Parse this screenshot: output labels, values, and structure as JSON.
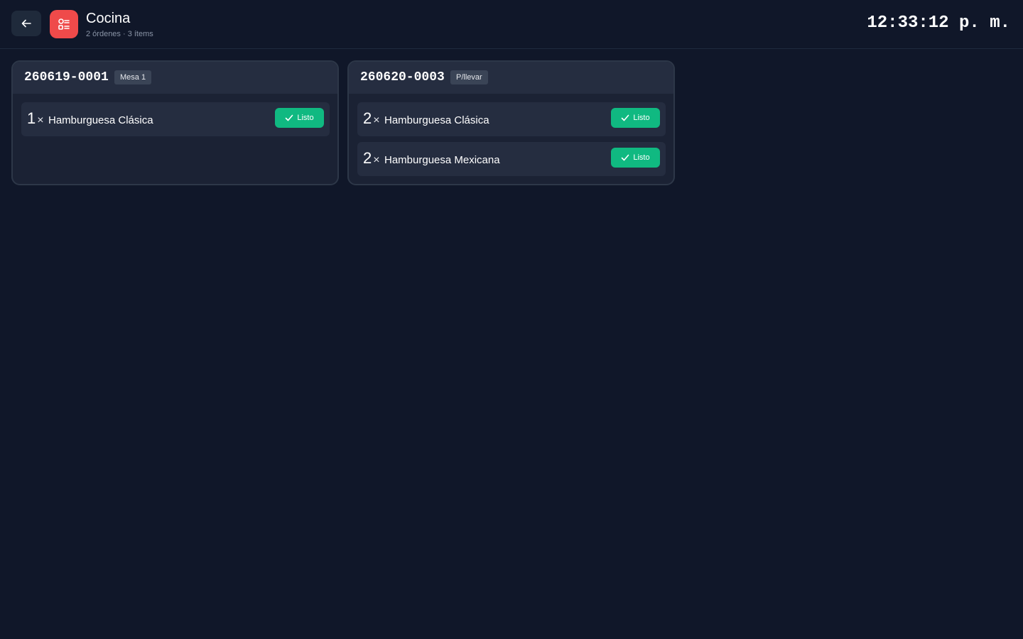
{
  "header": {
    "title": "Cocina",
    "subtitle": "2 órdenes · 3 ítems",
    "clock": "12:33:12 p. m.",
    "back_icon": "arrow-left-icon",
    "app_icon": "kitchen-ticket-icon"
  },
  "orders": [
    {
      "number": "260619-0001",
      "badge": "Mesa 1",
      "items": [
        {
          "qty": "1",
          "x": "×",
          "name": "Hamburguesa Clásica",
          "action": "Listo"
        }
      ]
    },
    {
      "number": "260620-0003",
      "badge": "P/llevar",
      "items": [
        {
          "qty": "2",
          "x": "×",
          "name": "Hamburguesa Clásica",
          "action": "Listo"
        },
        {
          "qty": "2",
          "x": "×",
          "name": "Hamburguesa Mexicana",
          "action": "Listo"
        }
      ]
    }
  ],
  "colors": {
    "background": "#101729",
    "card": "#1b2234",
    "accent_red": "#ef4a4a",
    "ready_green": "#10b981"
  }
}
